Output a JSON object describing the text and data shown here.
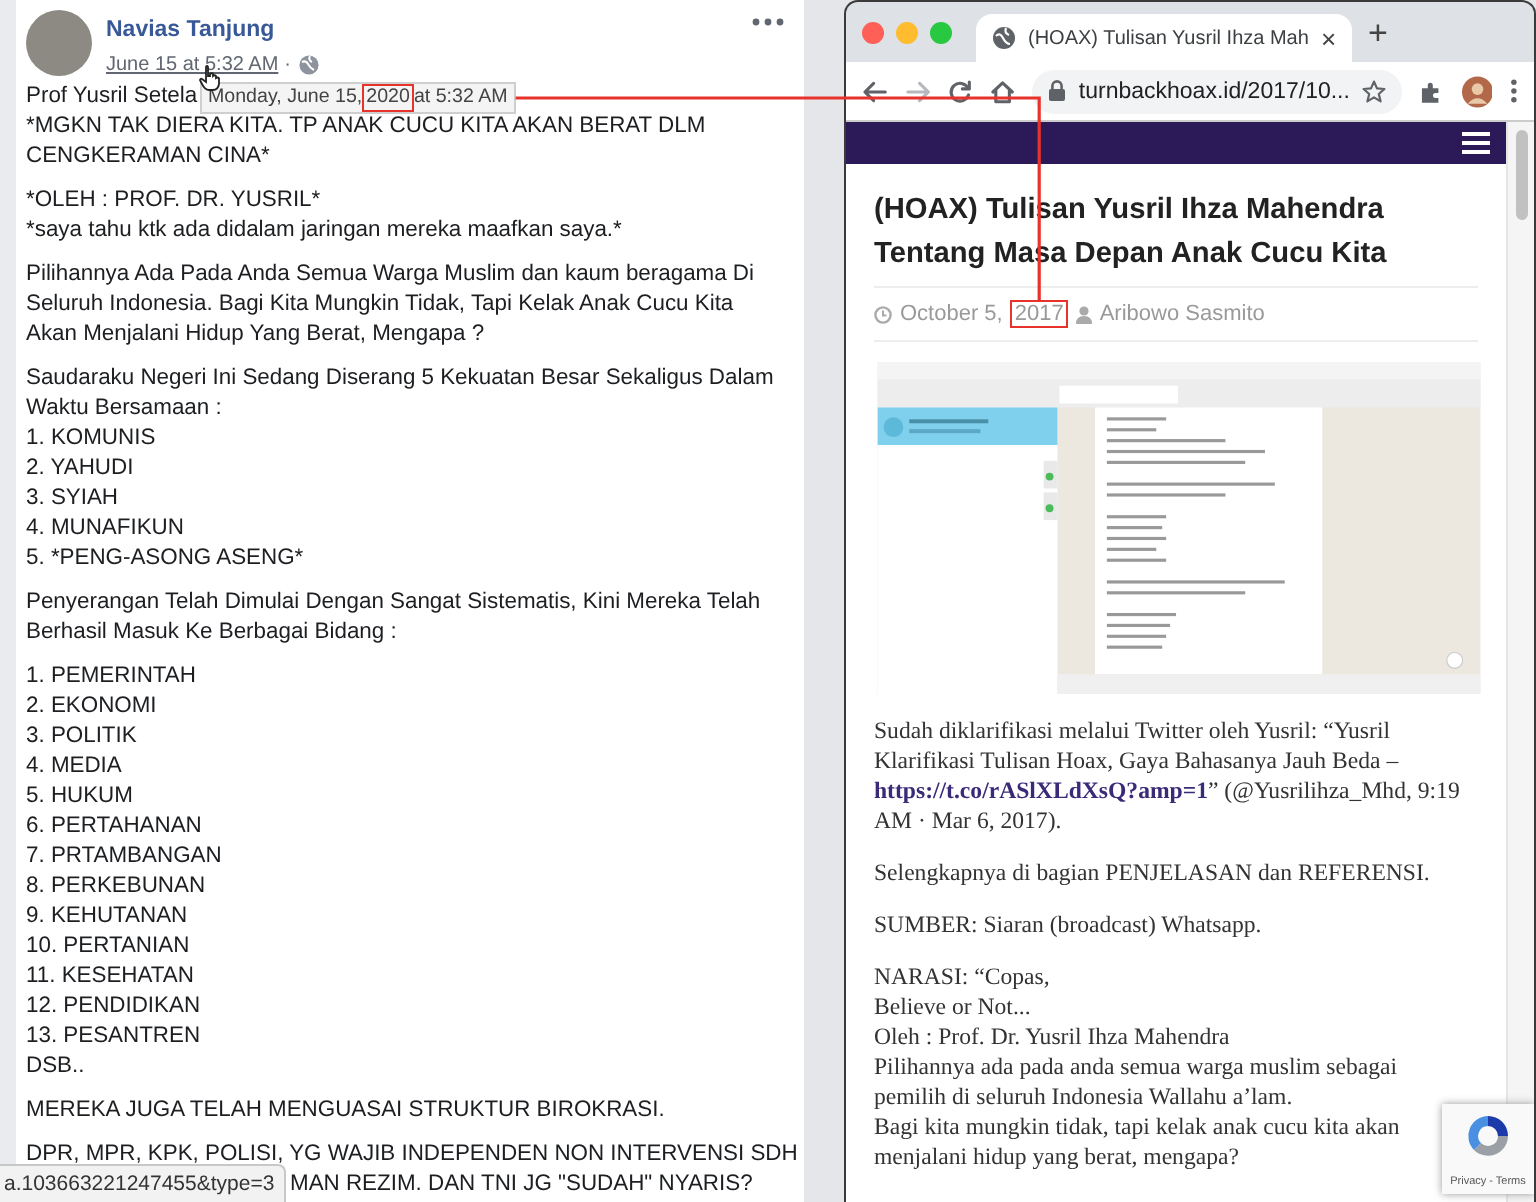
{
  "post": {
    "author": "Navias Tanjung",
    "timestamp": "June 15 at 5:32 AM",
    "separator": "·",
    "tooltip": {
      "before": "Monday, June 15, ",
      "highlight": "2020",
      "after": " at 5:32 AM"
    },
    "blocks": [
      {
        "kind": "text",
        "lines": [
          "Prof Yusril Setela",
          "*MGKN TAK DIERA KITA. TP ANAK CUCU KITA AKAN BERAT DLM\nCENGKERAMAN CINA*"
        ]
      },
      {
        "kind": "text",
        "lines": [
          "*OLEH : PROF. DR. YUSRIL*",
          "*saya tahu ktk ada didalam jaringan mereka maafkan saya.*"
        ]
      },
      {
        "kind": "text",
        "lines": [
          "Pilihannya Ada Pada Anda Semua Warga Muslim dan kaum beragama Di\nSeluruh Indonesia. Bagi Kita Mungkin Tidak, Tapi Kelak Anak Cucu Kita\nAkan Menjalani Hidup Yang Berat, Mengapa ?"
        ]
      },
      {
        "kind": "list",
        "lines": [
          "Saudaraku Negeri Ini Sedang Diserang 5 Kekuatan Besar Sekaligus Dalam\nWaktu Bersamaan :",
          "1. KOMUNIS",
          "2. YAHUDI",
          "3. SYIAH",
          "4. MUNAFIKUN",
          "5. *PENG-ASONG ASENG*"
        ]
      },
      {
        "kind": "text",
        "lines": [
          "Penyerangan Telah Dimulai Dengan Sangat Sistematis, Kini Mereka Telah\nBerhasil Masuk Ke Berbagai Bidang :"
        ]
      },
      {
        "kind": "list",
        "lines": [
          "1. PEMERINTAH",
          "2. EKONOMI",
          "3. POLITIK",
          "4. MEDIA",
          "5. HUKUM",
          "6. PERTAHANAN",
          "7. PRTAMBANGAN",
          "8. PERKEBUNAN",
          "9. KEHUTANAN",
          "10. PERTANIAN",
          "11. KESEHATAN",
          "12. PENDIDIKAN",
          "13. PESANTREN",
          "DSB.."
        ]
      },
      {
        "kind": "text",
        "lines": [
          "MEREKA JUGA TELAH MENGUASAI STRUKTUR BIROKRASI."
        ]
      },
      {
        "kind": "covered",
        "lines": [
          "DPR, MPR, KPK, POLISI, YG WAJIB INDEPENDEN NON INTERVENSI SDH",
          "MAN REZIM. DAN TNI JG \"SUDAH\" NYARIS?"
        ]
      }
    ]
  },
  "status_url": "a.103663221247455&type=3",
  "browser": {
    "tab_title": "(HOAX) Tulisan Yusril Ihza Mah",
    "tab_close": "×",
    "new_tab": "+",
    "url": "turnbackhoax.id/2017/10...",
    "article": {
      "title": "(HOAX) Tulisan Yusril Ihza Mahendra Tentang Masa Depan Anak Cucu Kita",
      "date": {
        "before": "October 5, ",
        "highlight": "2017"
      },
      "author": "Aribowo Sasmito",
      "paragraphs": [
        {
          "kind": "link",
          "before": "Sudah diklarifikasi melalui Twitter oleh Yusril: “Yusril Klarifikasi Tulisan Hoax, Gaya Bahasanya Jauh Beda – ",
          "link": "https://t.co/rASlXLdXsQ?amp=1",
          "after": "” (@Yusrilihza_Mhd, 9:19 AM · Mar 6, 2017)."
        },
        {
          "kind": "text",
          "text": "Selengkapnya di bagian PENJELASAN dan REFERENSI."
        },
        {
          "kind": "text",
          "text": "SUMBER: Siaran (broadcast) Whatsapp."
        },
        {
          "kind": "text",
          "text": "NARASI: “Copas,\nBelieve or Not...\nOleh : Prof. Dr. Yusril Ihza Mahendra\nPilihannya ada pada anda semua warga muslim sebagai\npemilih di seluruh Indonesia Wallahu a’lam.\nBagi kita mungkin tidak, tapi kelak anak cucu kita akan\nmenjalani hidup yang berat, mengapa?"
        }
      ]
    },
    "recaptcha": "Privacy - Terms"
  }
}
